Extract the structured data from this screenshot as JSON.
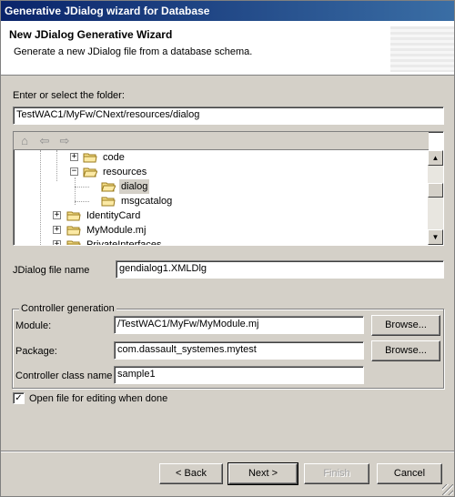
{
  "window": {
    "title": "Generative JDialog wizard for Database"
  },
  "header": {
    "title": "New JDialog Generative Wizard",
    "description": "Generate a new JDialog file from a database schema."
  },
  "folder": {
    "label": "Enter or select the folder:",
    "value": "TestWAC1/MyFw/CNext/resources/dialog"
  },
  "tree": {
    "items": [
      {
        "label": "code",
        "expander": "+",
        "selected": false
      },
      {
        "label": "resources",
        "expander": "−",
        "selected": false
      },
      {
        "label": "dialog",
        "expander": "",
        "selected": true
      },
      {
        "label": "msgcatalog",
        "expander": "",
        "selected": false
      },
      {
        "label": "IdentityCard",
        "expander": "+",
        "selected": false
      },
      {
        "label": "MyModule.mj",
        "expander": "+",
        "selected": false
      },
      {
        "label": "PrivateInterfaces",
        "expander": "+",
        "selected": false
      }
    ]
  },
  "file_name": {
    "label": "JDialog file name",
    "value": "gendialog1.XMLDlg"
  },
  "controller": {
    "legend": "Controller generation",
    "module_label": "Module:",
    "module_value": "/TestWAC1/MyFw/MyModule.mj",
    "package_label": "Package:",
    "package_value": "com.dassault_systemes.mytest",
    "class_label": "Controller class name",
    "class_value": "sample1",
    "browse_label": "Browse..."
  },
  "open_file": {
    "label": "Open file for editing when done",
    "checked": true
  },
  "buttons": {
    "back": "< Back",
    "next": "Next >",
    "finish": "Finish",
    "cancel": "Cancel"
  }
}
